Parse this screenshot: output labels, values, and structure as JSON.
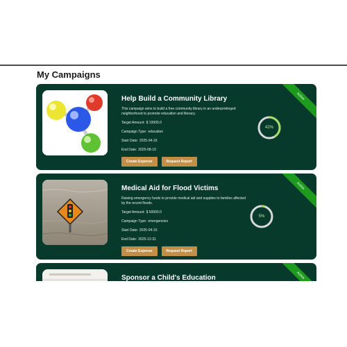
{
  "page": {
    "title": "My Campaigns"
  },
  "colors": {
    "card_bg": "#073a2b",
    "button": "#c28f48",
    "ribbon": "#1e9a1e",
    "progress_track": "#d9d9d9",
    "progress_fill": "#a6d96a"
  },
  "campaigns": [
    {
      "title": "Help Build a Community Library",
      "description": "This campaign aims to build a free community library in an underprivileged neighborhood to promote education and literacy.",
      "target_label": "Target Amount:",
      "target_value": "$ 10000.0",
      "type_label": "Campaign Type:",
      "type_value": "education",
      "start_label": "Start Date:",
      "start_value": "2025-04-16",
      "end_label": "End Date:",
      "end_value": "2025-08-19",
      "status": "Active",
      "progress_text": "42%",
      "progress": 0.42,
      "create_label": "Create Expense",
      "report_label": "Request Report",
      "image_icon": "molecule-graphic"
    },
    {
      "title": "Medical Aid for Flood Victims",
      "description": "Raising emergency funds to provide medical aid and supplies to families affected by the recent floods.",
      "target_label": "Target Amount:",
      "target_value": "$ 50000.0",
      "type_label": "Campaign Type:",
      "type_value": "emergencies",
      "start_label": "Start Date:",
      "start_value": "2025-04-15",
      "end_label": "End Date:",
      "end_value": "2025-12-31",
      "status": "Active",
      "progress_text": "5%",
      "progress": 0.05,
      "create_label": "Create Expense",
      "report_label": "Request Report",
      "image_icon": "flood-sign-photo"
    },
    {
      "title": "Sponsor a Child's Education",
      "status": "Active",
      "image_icon": "classroom-photo"
    }
  ]
}
